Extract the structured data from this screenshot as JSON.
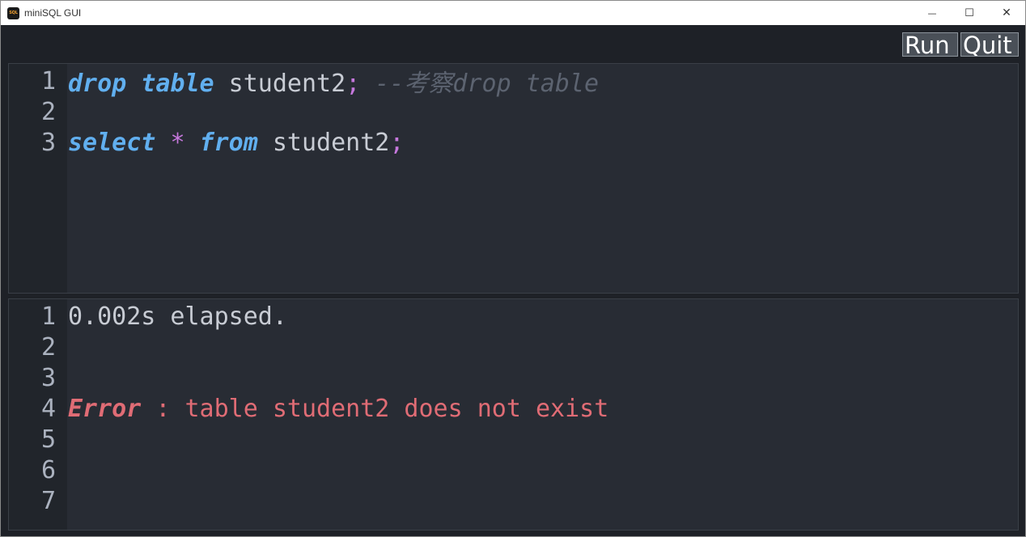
{
  "window": {
    "title": "miniSQL GUI",
    "icon_label": "SQL",
    "controls": {
      "minimize": "—",
      "maximize": "☐",
      "close": "✕"
    }
  },
  "toolbar": {
    "run_label": "Run",
    "quit_label": "Quit"
  },
  "editor": {
    "line_numbers": [
      "1",
      "2",
      "3"
    ],
    "lines": [
      [
        {
          "text": "drop",
          "kind": "keyword"
        },
        {
          "text": " ",
          "kind": "plain"
        },
        {
          "text": "table",
          "kind": "keyword"
        },
        {
          "text": " student2",
          "kind": "plain"
        },
        {
          "text": ";",
          "kind": "operator"
        },
        {
          "text": " --考察drop table",
          "kind": "comment"
        }
      ],
      [],
      [
        {
          "text": "select",
          "kind": "keyword"
        },
        {
          "text": " ",
          "kind": "plain"
        },
        {
          "text": "*",
          "kind": "operator"
        },
        {
          "text": " ",
          "kind": "plain"
        },
        {
          "text": "from",
          "kind": "keyword"
        },
        {
          "text": " student2",
          "kind": "plain"
        },
        {
          "text": ";",
          "kind": "operator"
        }
      ]
    ]
  },
  "output": {
    "line_numbers": [
      "1",
      "2",
      "3",
      "4",
      "5",
      "6",
      "7"
    ],
    "lines": [
      [
        {
          "text": "0.002s elapsed.",
          "kind": "plain"
        }
      ],
      [],
      [],
      [
        {
          "text": "Error",
          "kind": "error-keyword"
        },
        {
          "text": " : table student2 does not exist",
          "kind": "error"
        }
      ],
      [],
      [],
      []
    ]
  },
  "colors": {
    "background": "#1e2127",
    "pane": "#282c34",
    "keyword": "#61afef",
    "operator": "#c678dd",
    "comment": "#5c6370",
    "error": "#e06c75"
  }
}
